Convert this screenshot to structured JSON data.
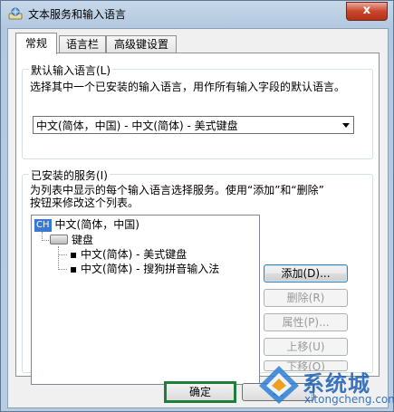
{
  "window": {
    "title": "文本服务和输入语言",
    "close_symbol": "x",
    "title_icon": "keyboard-globe-icon"
  },
  "tabs": [
    {
      "label": "常规",
      "active": true
    },
    {
      "label": "语言栏",
      "active": false
    },
    {
      "label": "高级键设置",
      "active": false
    }
  ],
  "default_language": {
    "label": "默认输入语言(L)",
    "description": "选择其中一个已安装的输入语言，用作所有输入字段的默认语言。",
    "selected": "中文(简体，中国) - 中文(简体) - 美式键盘"
  },
  "installed_services": {
    "label": "已安装的服务(I)",
    "description_line1": "为列表中显示的每个输入语言选择服务。使用“添加”和“删除”",
    "description_line2": "按钮来修改这个列表。",
    "tree": {
      "language_badge": "CH",
      "language": "中文(简体，中国)",
      "category": "键盘",
      "items": [
        "中文(简体) - 美式键盘",
        "中文(简体) - 搜狗拼音输入法"
      ]
    },
    "buttons": {
      "add": "添加(D)...",
      "remove": "删除(R)",
      "properties": "属性(P)...",
      "move_up": "上移(U)",
      "move_down": "下移(O)"
    }
  },
  "footer": {
    "ok": "确定",
    "next_partial": "取"
  },
  "watermark": {
    "brand": "系统城",
    "url": "xitongcheng.com"
  },
  "colors": {
    "accent": "#3b78d0",
    "ok_border": "#1f7f3a",
    "close_button": "#c9462c"
  }
}
